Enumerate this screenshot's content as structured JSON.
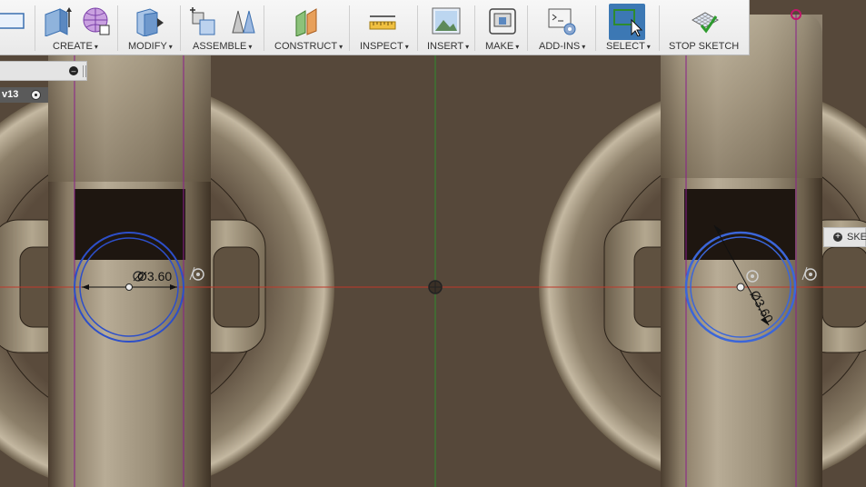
{
  "toolbar": {
    "groups": [
      {
        "label": "CREATE"
      },
      {
        "label": "MODIFY"
      },
      {
        "label": "ASSEMBLE"
      },
      {
        "label": "CONSTRUCT"
      },
      {
        "label": "INSPECT"
      },
      {
        "label": "INSERT"
      },
      {
        "label": "MAKE"
      },
      {
        "label": "ADD-INS"
      },
      {
        "label": "SELECT"
      },
      {
        "label": "STOP SKETCH"
      }
    ],
    "caret": "▾"
  },
  "browser": {
    "component_label": "v13"
  },
  "sketch_palette": {
    "label": "SKET"
  },
  "dimensions": {
    "left": "Ø3.60",
    "right": "Ø3.60"
  },
  "colors": {
    "background": "#56483a",
    "x_axis": "#c0392b",
    "y_axis": "#2e8b2e",
    "sketch_circle": "#2d4fc9",
    "construction_line": "#8b1f8b",
    "select_active": "#3c78b4"
  }
}
